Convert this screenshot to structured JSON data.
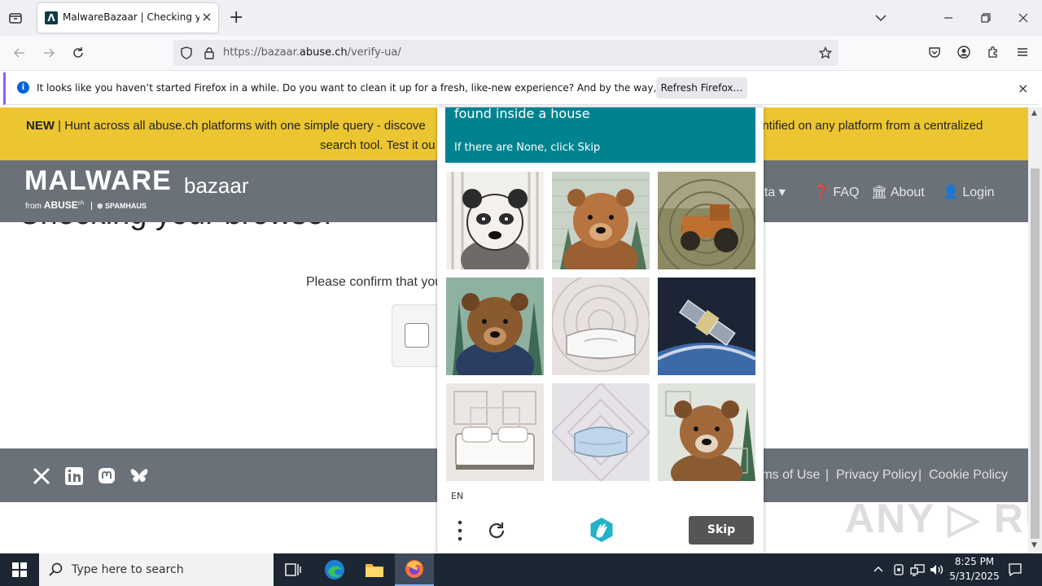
{
  "browser": {
    "tab_title": "MalwareBazaar | Checking your browser",
    "tab_favicon": "malwarebazaar-favicon",
    "new_tab": "+",
    "url_prefix": "https://bazaar.",
    "url_domain": "abuse.ch",
    "url_path": "/verify-ua/"
  },
  "notification": {
    "message": "It looks like you haven’t started Firefox in a while. Do you want to clean it up for a fresh, like-new experience? And by the way, welcome back!",
    "button": "Refresh Firefox…"
  },
  "banner": {
    "new_label": "NEW",
    "line1_start": " | Hunt across all abuse.ch platforms with one simple query - discove",
    "line1_end": "entified on any platform from a centralized",
    "line2": "search tool. Test it ou"
  },
  "header": {
    "logo_main": "MALWARE",
    "logo_sub": "bazaar",
    "logo_from": "from",
    "logo_abuse": "ABUSE",
    "logo_spamhaus": "SPAMHAUS",
    "nav": {
      "data": "ata",
      "faq": "FAQ",
      "about": "About",
      "login": "Login"
    }
  },
  "main": {
    "heading": "Checking your browser",
    "confirm_text": "Please confirm that you"
  },
  "footer": {
    "links": [
      "rms of Use",
      "Privacy Policy",
      "Cookie Policy"
    ],
    "separator": "|"
  },
  "captcha": {
    "prompt_line1": "found inside a house",
    "prompt_line2": "If there are None, click Skip",
    "language": "EN",
    "skip_label": "Skip",
    "tiles": [
      "bear-sketch",
      "bear-brown",
      "tractor",
      "bear-forest",
      "pillow-gray",
      "satellite",
      "bed-white",
      "pillow-blue",
      "bear-portrait"
    ]
  },
  "watermark": "ANY ▷ RUN",
  "taskbar": {
    "search_placeholder": "Type here to search",
    "time": "8:25 PM",
    "date": "5/31/2025"
  }
}
